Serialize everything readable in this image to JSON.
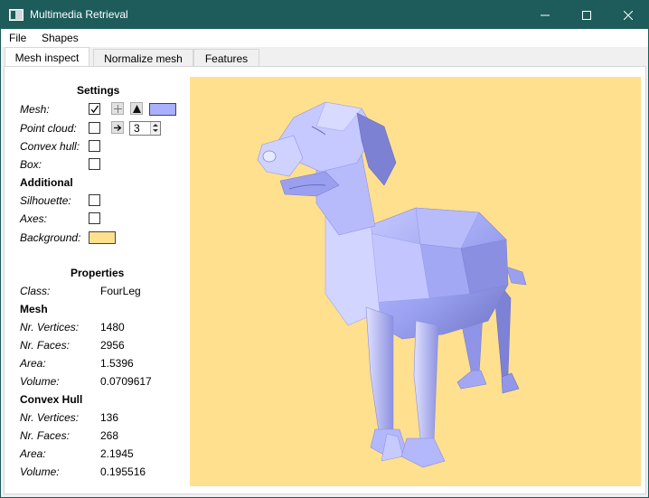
{
  "window": {
    "title": "Multimedia Retrieval",
    "accent_color": "#1d5c5a"
  },
  "menu": {
    "items": [
      "File",
      "Shapes"
    ]
  },
  "tabs": [
    "Mesh inspect",
    "Normalize mesh",
    "Features"
  ],
  "settings": {
    "heading": "Settings",
    "mesh_label": "Mesh:",
    "mesh_checked": true,
    "mesh_color": "#aab0ff",
    "point_cloud_label": "Point cloud:",
    "point_cloud_checked": false,
    "point_size": "3",
    "convex_hull_label": "Convex hull:",
    "convex_hull_checked": false,
    "box_label": "Box:",
    "box_checked": false,
    "additional_heading": "Additional",
    "silhouette_label": "Silhouette:",
    "silhouette_checked": false,
    "axes_label": "Axes:",
    "axes_checked": false,
    "background_label": "Background:",
    "background_color": "#ffe08e"
  },
  "properties": {
    "heading": "Properties",
    "class_label": "Class:",
    "class_value": "FourLeg",
    "mesh_heading": "Mesh",
    "hull_heading": "Convex Hull",
    "vertices_label": "Nr. Vertices:",
    "faces_label": "Nr. Faces:",
    "area_label": "Area:",
    "volume_label": "Volume:",
    "mesh": {
      "vertices": "1480",
      "faces": "2956",
      "area": "1.5396",
      "volume": "0.0709617"
    },
    "hull": {
      "vertices": "136",
      "faces": "268",
      "area": "2.1945",
      "volume": "0.195516"
    }
  },
  "icons": {
    "mesh_wire": "plus-grid-icon",
    "mesh_solid": "triangle-icon",
    "point_arrow": "arrow-right-icon"
  }
}
